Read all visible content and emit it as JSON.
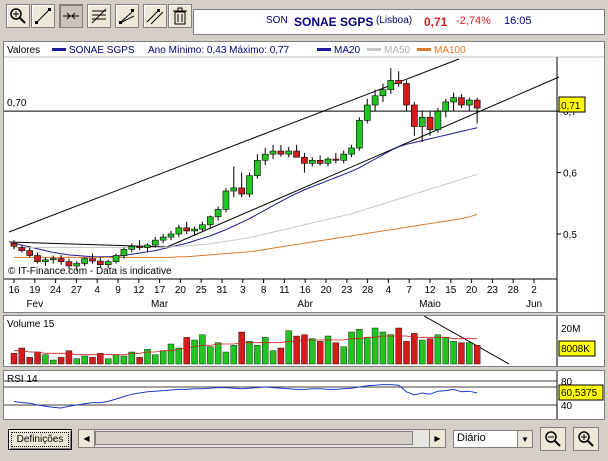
{
  "toolbar": {
    "buttons": [
      {
        "name": "zoom-tool",
        "icon": "magnifier-plus-icon"
      },
      {
        "name": "draw-line-tool",
        "icon": "diagonal-line-icon"
      },
      {
        "name": "horizontal-line-tool",
        "icon": "horizontal-line-icon"
      },
      {
        "name": "fibonacci-tool",
        "icon": "fibonacci-icon"
      },
      {
        "name": "fan-tool",
        "icon": "fan-lines-icon"
      },
      {
        "name": "parallel-line-tool",
        "icon": "parallel-lines-icon"
      },
      {
        "name": "delete-tool",
        "icon": "trash-icon"
      }
    ]
  },
  "quote": {
    "code": "SON",
    "name": "SONAE SGPS",
    "market": "(Lisboa)",
    "price": "0,71",
    "change": "-2,74%",
    "time": "16:05"
  },
  "price_panel": {
    "header_title": "Valores",
    "header_series": "SONAE SGPS",
    "header_range": "Ano Mínimo: 0,43 Máximo: 0,77",
    "legend": [
      "MA20",
      "MA50",
      "MA100"
    ],
    "hline_label": "0,70",
    "price_tag": "0,71",
    "credit": "© IT-Finance.com - Data is indicative",
    "day_ticks": [
      "16",
      "19",
      "24",
      "27",
      "4",
      "9",
      "12",
      "17",
      "20",
      "25",
      "31",
      "3",
      "8",
      "11",
      "16",
      "20",
      "23",
      "28",
      "4",
      "7",
      "12",
      "15",
      "20",
      "23",
      "28",
      "2"
    ],
    "month_ticks": [
      "Fev",
      "Mar",
      "Abr",
      "Maio",
      "Jun"
    ]
  },
  "volume_panel": {
    "title": "Volume 15",
    "axis_label": "20M",
    "value_tag": "8008K"
  },
  "rsi_panel": {
    "title": "RSI 14",
    "axis_top": "80",
    "axis_bottom": "40",
    "value_tag": "60,5375"
  },
  "bottom": {
    "settings_label": "Definições",
    "period_selected": "Diário"
  },
  "colors": {
    "up": "#22c422",
    "down": "#d41c1c",
    "ma20": "#1a1a9a",
    "ma50": "#c8c8c8",
    "ma100": "#e07828",
    "price_tag_bg": "#ffff00",
    "accent": "#000080"
  },
  "chart_data": [
    {
      "type": "candlestick",
      "title": "SONAE SGPS",
      "yticks": [
        "0,5",
        "0,6",
        "0,7"
      ],
      "series": [
        {
          "name": "SONAE SGPS",
          "ohlc": [
            [
              0.485,
              0.49,
              0.475,
              0.48
            ],
            [
              0.478,
              0.482,
              0.47,
              0.473
            ],
            [
              0.473,
              0.478,
              0.462,
              0.465
            ],
            [
              0.465,
              0.47,
              0.452,
              0.455
            ],
            [
              0.455,
              0.462,
              0.448,
              0.458
            ],
            [
              0.458,
              0.465,
              0.452,
              0.46
            ],
            [
              0.46,
              0.466,
              0.45,
              0.455
            ],
            [
              0.455,
              0.46,
              0.443,
              0.448
            ],
            [
              0.448,
              0.456,
              0.44,
              0.452
            ],
            [
              0.452,
              0.462,
              0.448,
              0.46
            ],
            [
              0.46,
              0.468,
              0.452,
              0.456
            ],
            [
              0.456,
              0.462,
              0.446,
              0.45
            ],
            [
              0.45,
              0.458,
              0.444,
              0.455
            ],
            [
              0.455,
              0.468,
              0.452,
              0.465
            ],
            [
              0.465,
              0.478,
              0.46,
              0.475
            ],
            [
              0.475,
              0.485,
              0.47,
              0.48
            ],
            [
              0.48,
              0.49,
              0.474,
              0.478
            ],
            [
              0.478,
              0.485,
              0.47,
              0.482
            ],
            [
              0.482,
              0.495,
              0.478,
              0.49
            ],
            [
              0.49,
              0.5,
              0.485,
              0.495
            ],
            [
              0.495,
              0.505,
              0.49,
              0.5
            ],
            [
              0.5,
              0.515,
              0.495,
              0.51
            ],
            [
              0.51,
              0.52,
              0.5,
              0.505
            ],
            [
              0.505,
              0.512,
              0.498,
              0.508
            ],
            [
              0.508,
              0.52,
              0.505,
              0.515
            ],
            [
              0.515,
              0.53,
              0.51,
              0.528
            ],
            [
              0.528,
              0.545,
              0.522,
              0.54
            ],
            [
              0.54,
              0.575,
              0.535,
              0.57
            ],
            [
              0.57,
              0.61,
              0.56,
              0.575
            ],
            [
              0.575,
              0.6,
              0.56,
              0.565
            ],
            [
              0.565,
              0.6,
              0.56,
              0.595
            ],
            [
              0.595,
              0.63,
              0.59,
              0.62
            ],
            [
              0.62,
              0.64,
              0.612,
              0.63
            ],
            [
              0.63,
              0.645,
              0.622,
              0.635
            ],
            [
              0.635,
              0.645,
              0.626,
              0.63
            ],
            [
              0.63,
              0.642,
              0.625,
              0.635
            ],
            [
              0.635,
              0.645,
              0.63,
              0.625
            ],
            [
              0.625,
              0.632,
              0.6,
              0.615
            ],
            [
              0.615,
              0.625,
              0.61,
              0.62
            ],
            [
              0.62,
              0.628,
              0.612,
              0.615
            ],
            [
              0.615,
              0.625,
              0.61,
              0.622
            ],
            [
              0.622,
              0.632,
              0.615,
              0.62
            ],
            [
              0.62,
              0.636,
              0.615,
              0.63
            ],
            [
              0.63,
              0.645,
              0.625,
              0.64
            ],
            [
              0.64,
              0.69,
              0.636,
              0.685
            ],
            [
              0.685,
              0.72,
              0.68,
              0.71
            ],
            [
              0.71,
              0.735,
              0.7,
              0.725
            ],
            [
              0.725,
              0.745,
              0.715,
              0.735
            ],
            [
              0.735,
              0.77,
              0.728,
              0.75
            ],
            [
              0.75,
              0.765,
              0.74,
              0.745
            ],
            [
              0.745,
              0.75,
              0.7,
              0.71
            ],
            [
              0.71,
              0.715,
              0.66,
              0.675
            ],
            [
              0.675,
              0.7,
              0.65,
              0.69
            ],
            [
              0.69,
              0.7,
              0.66,
              0.67
            ],
            [
              0.67,
              0.705,
              0.665,
              0.7
            ],
            [
              0.7,
              0.72,
              0.69,
              0.715
            ],
            [
              0.715,
              0.73,
              0.7,
              0.722
            ],
            [
              0.722,
              0.728,
              0.705,
              0.71
            ],
            [
              0.71,
              0.722,
              0.7,
              0.718
            ],
            [
              0.718,
              0.722,
              0.68,
              0.705
            ]
          ]
        },
        {
          "name": "MA20",
          "values": [
            0.485,
            0.482,
            0.479,
            0.476,
            0.473,
            0.47,
            0.468,
            0.466,
            0.465,
            0.464,
            0.463,
            0.463,
            0.463,
            0.464,
            0.465,
            0.467,
            0.469,
            0.471,
            0.473,
            0.476,
            0.479,
            0.482,
            0.485,
            0.489,
            0.493,
            0.497,
            0.502,
            0.507,
            0.513,
            0.519,
            0.525,
            0.532,
            0.539,
            0.546,
            0.553,
            0.56,
            0.566,
            0.572,
            0.577,
            0.582,
            0.587,
            0.592,
            0.597,
            0.602,
            0.608,
            0.615,
            0.622,
            0.629,
            0.636,
            0.642,
            0.646,
            0.649,
            0.652,
            0.655,
            0.658,
            0.661,
            0.664,
            0.667,
            0.67,
            0.673
          ]
        },
        {
          "name": "MA50",
          "values": [
            0.478,
            0.478,
            0.478,
            0.478,
            0.478,
            0.478,
            0.478,
            0.478,
            0.478,
            0.478,
            0.478,
            0.478,
            0.478,
            0.478,
            0.478,
            0.478,
            0.478,
            0.478,
            0.478,
            0.478,
            0.479,
            0.48,
            0.481,
            0.482,
            0.483,
            0.484,
            0.486,
            0.488,
            0.49,
            0.492,
            0.494,
            0.497,
            0.5,
            0.503,
            0.506,
            0.509,
            0.512,
            0.515,
            0.518,
            0.521,
            0.524,
            0.527,
            0.53,
            0.533,
            0.537,
            0.541,
            0.545,
            0.549,
            0.553,
            0.557,
            0.561,
            0.565,
            0.569,
            0.573,
            0.577,
            0.581,
            0.585,
            0.589,
            0.593,
            0.597
          ]
        },
        {
          "name": "MA100",
          "values": [
            0.462,
            0.462,
            0.462,
            0.462,
            0.462,
            0.462,
            0.462,
            0.462,
            0.462,
            0.462,
            0.462,
            0.462,
            0.462,
            0.462,
            0.462,
            0.462,
            0.462,
            0.462,
            0.462,
            0.462,
            0.462,
            0.463,
            0.463,
            0.464,
            0.465,
            0.466,
            0.467,
            0.468,
            0.469,
            0.47,
            0.471,
            0.473,
            0.475,
            0.477,
            0.479,
            0.481,
            0.483,
            0.485,
            0.487,
            0.489,
            0.491,
            0.493,
            0.495,
            0.497,
            0.499,
            0.501,
            0.503,
            0.505,
            0.507,
            0.509,
            0.511,
            0.513,
            0.515,
            0.517,
            0.519,
            0.521,
            0.523,
            0.525,
            0.528,
            0.532
          ]
        }
      ],
      "ylim": [
        0.43,
        0.78
      ],
      "hline": 0.7
    },
    {
      "type": "bar",
      "title": "Volume 15",
      "values": [
        8,
        12,
        5,
        9,
        7,
        3,
        5,
        10,
        4,
        6,
        5,
        8,
        4,
        7,
        6,
        9,
        5,
        11,
        7,
        10,
        15,
        12,
        20,
        18,
        22,
        13,
        16,
        9,
        14,
        24,
        17,
        14,
        20,
        10,
        12,
        25,
        21,
        22,
        19,
        17,
        21,
        16,
        13,
        24,
        26,
        20,
        27,
        24,
        22,
        27,
        17,
        23,
        18,
        19,
        22,
        20,
        17,
        16,
        16,
        14
      ],
      "colors_updown": "up/down by candle",
      "ma_line": [
        10,
        10,
        9,
        9,
        8,
        8,
        8,
        8,
        7,
        7,
        7,
        7,
        7,
        7,
        7,
        8,
        8,
        9,
        9,
        10,
        10,
        11,
        12,
        13,
        14,
        14,
        15,
        15,
        15,
        16,
        16,
        16,
        16,
        16,
        16,
        17,
        17,
        18,
        18,
        18,
        18,
        18,
        18,
        19,
        19,
        20,
        20,
        21,
        21,
        21,
        21,
        20,
        20,
        20,
        20,
        20,
        19,
        19,
        19,
        19
      ],
      "ylim": [
        0,
        30
      ]
    },
    {
      "type": "line",
      "title": "RSI 14",
      "values": [
        46,
        44,
        43,
        40,
        38,
        36,
        35,
        38,
        40,
        42,
        44,
        44,
        46,
        50,
        54,
        58,
        60,
        62,
        63,
        64,
        65,
        66,
        66,
        67,
        67,
        68,
        69,
        69,
        68,
        67,
        68,
        69,
        70,
        69,
        68,
        67,
        66,
        66,
        67,
        67,
        66,
        66,
        67,
        68,
        70,
        72,
        73,
        74,
        74,
        73,
        62,
        57,
        60,
        58,
        63,
        64,
        66,
        62,
        63,
        60
      ],
      "ylim": [
        20,
        90
      ],
      "levels": [
        80,
        70,
        40
      ]
    }
  ]
}
